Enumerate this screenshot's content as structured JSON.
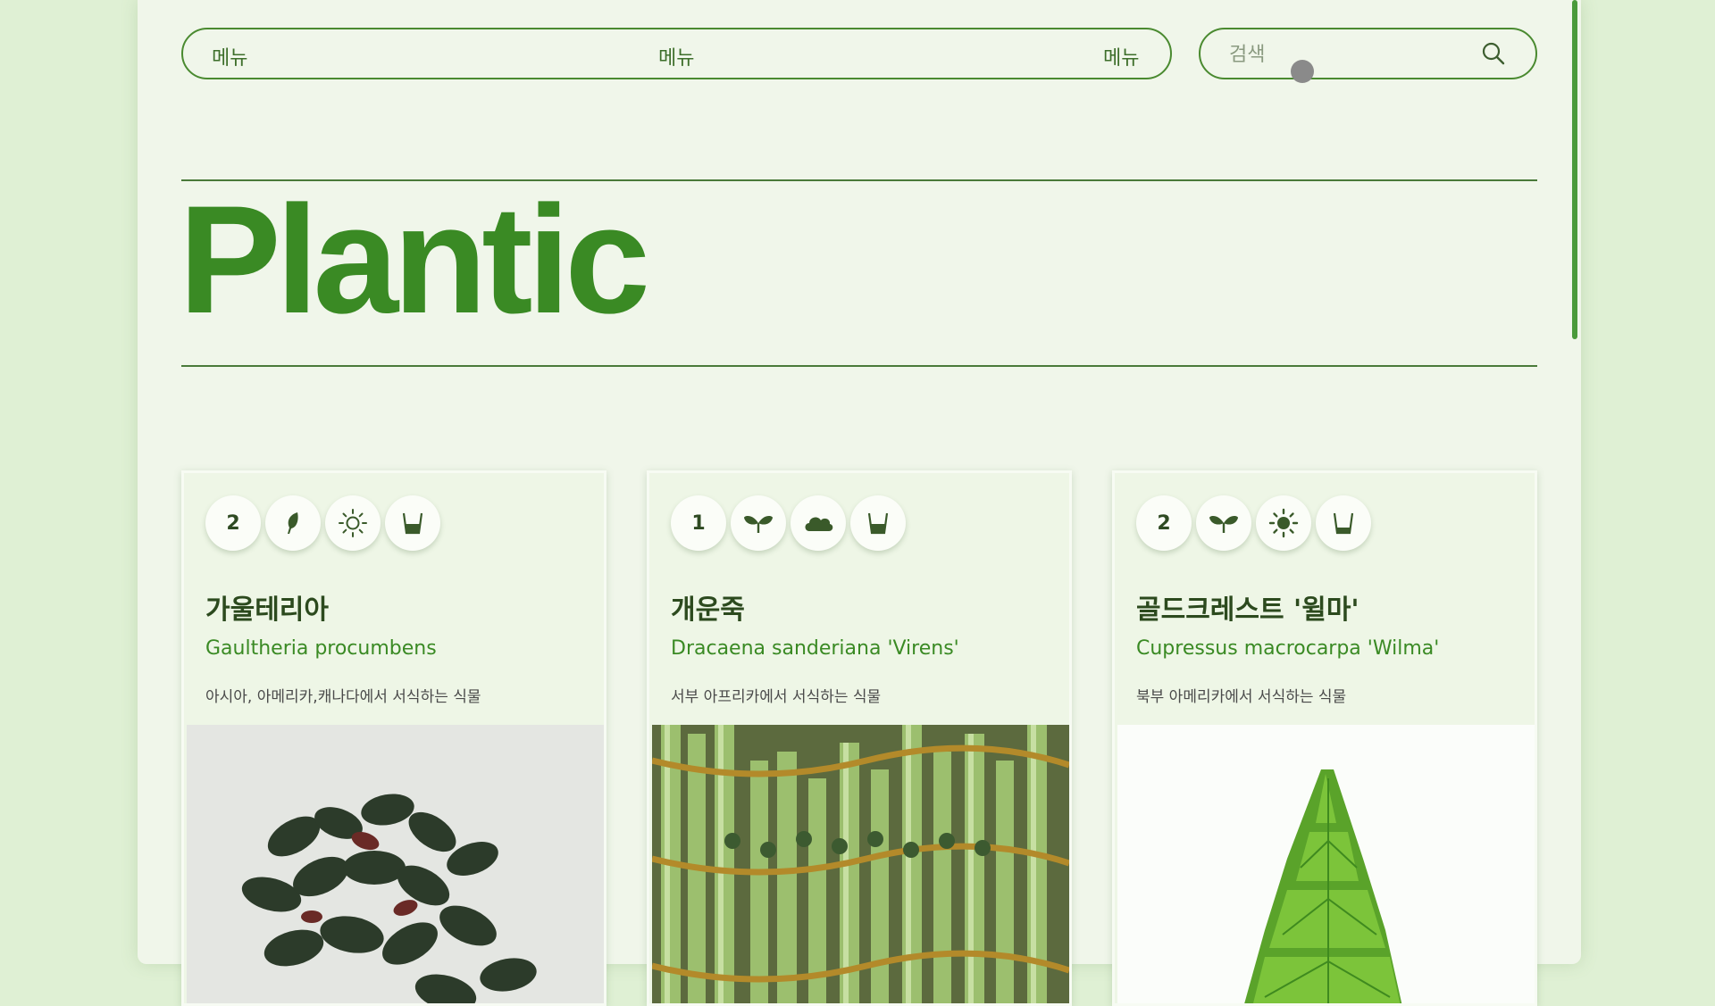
{
  "nav": {
    "menu_items": [
      "메뉴",
      "메뉴",
      "메뉴"
    ]
  },
  "search": {
    "placeholder": "검색",
    "icon": "search-icon"
  },
  "brand": {
    "logo": "Plantic",
    "color": "#3a8a24"
  },
  "colors": {
    "accent": "#3a8a24",
    "border": "#4a8a30",
    "background": "#dff0d4"
  },
  "cards": [
    {
      "badge_number": "2",
      "icons": [
        "leaf-icon",
        "sun-outline-icon",
        "water-cup-icon"
      ],
      "name": "가울테리아",
      "scientific_name": "Gaultheria procumbens",
      "description": "아시아, 아메리카,캐나다에서 서식하는 식물"
    },
    {
      "badge_number": "1",
      "icons": [
        "sprout-icon",
        "cloud-icon",
        "water-cup-icon"
      ],
      "name": "개운죽",
      "scientific_name": "Dracaena sanderiana 'Virens'",
      "description": "서부 아프리카에서 서식하는 식물"
    },
    {
      "badge_number": "2",
      "icons": [
        "sprout-icon",
        "sun-filled-icon",
        "water-cup-icon"
      ],
      "name": "골드크레스트 '윌마'",
      "scientific_name": "Cupressus macrocarpa 'Wilma'",
      "description": "북부 아메리카에서 서식하는 식물"
    }
  ]
}
